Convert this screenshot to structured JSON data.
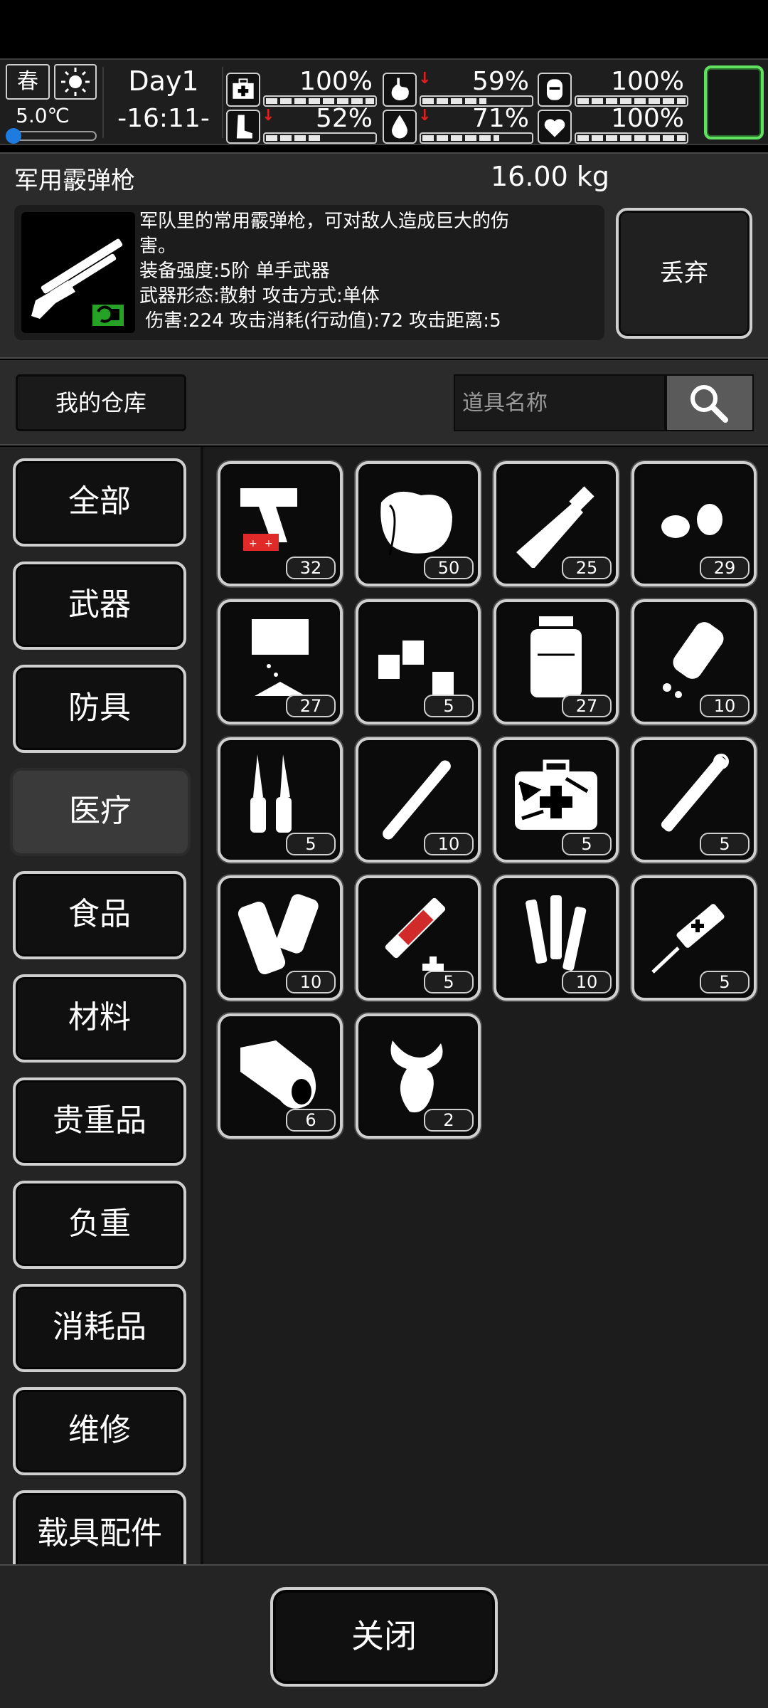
{
  "status": {
    "season": "春",
    "temperature": "5.0℃",
    "temperature_level": 0.1,
    "day": "Day1",
    "time": "-16:11-",
    "stats": [
      {
        "icon": "medkit-icon",
        "value": "100%",
        "level": 1.0,
        "decreasing": false
      },
      {
        "icon": "stomach-icon",
        "value": "59%",
        "level": 0.59,
        "decreasing": true
      },
      {
        "icon": "bladder-icon",
        "value": "100%",
        "level": 1.0,
        "decreasing": false
      },
      {
        "icon": "leg-icon",
        "value": "52%",
        "level": 0.52,
        "decreasing": true
      },
      {
        "icon": "water-drop-icon",
        "value": "71%",
        "level": 0.71,
        "decreasing": true
      },
      {
        "icon": "heart-icon",
        "value": "100%",
        "level": 1.0,
        "decreasing": false
      }
    ],
    "accent_color": "#5fe05f"
  },
  "selected_item": {
    "name": "军用霰弹枪",
    "weight": "16.00 kg",
    "description_lines": [
      "军队里的常用霰弹枪，可对敌人造成巨大的伤",
      "害。",
      "装备强度:5阶 单手武器",
      "武器形态:散射 攻击方式:单体",
      " 伤害:224 攻击消耗(行动值):72 攻击距离:5"
    ],
    "discard_label": "丢弃"
  },
  "warehouse": {
    "label": "我的仓库",
    "search_placeholder": "道具名称"
  },
  "categories": [
    {
      "label": "全部",
      "active": false
    },
    {
      "label": "武器",
      "active": false
    },
    {
      "label": "防具",
      "active": false
    },
    {
      "label": "医疗",
      "active": true
    },
    {
      "label": "食品",
      "active": false
    },
    {
      "label": "材料",
      "active": false
    },
    {
      "label": "贵重品",
      "active": false
    },
    {
      "label": "负重",
      "active": false
    },
    {
      "label": "消耗品",
      "active": false
    },
    {
      "label": "维修",
      "active": false
    },
    {
      "label": "载具配件",
      "active": false
    }
  ],
  "items": [
    {
      "icon": "flare-gun-icon",
      "qty": "32"
    },
    {
      "icon": "bandage-roll-icon",
      "qty": "50"
    },
    {
      "icon": "ointment-tube-icon",
      "qty": "25"
    },
    {
      "icon": "pills-icon",
      "qty": "29"
    },
    {
      "icon": "cloth-icon",
      "qty": "27"
    },
    {
      "icon": "small-bottles-icon",
      "qty": "5"
    },
    {
      "icon": "medicine-jar-icon",
      "qty": "27"
    },
    {
      "icon": "pill-bottle-icon",
      "qty": "10"
    },
    {
      "icon": "ampoules-icon",
      "qty": "5"
    },
    {
      "icon": "tube-icon",
      "qty": "10"
    },
    {
      "icon": "camo-medkit-icon",
      "qty": "5"
    },
    {
      "icon": "injector-pen-icon",
      "qty": "5"
    },
    {
      "icon": "splint-icon",
      "qty": "10"
    },
    {
      "icon": "red-syringe-icon",
      "qty": "5"
    },
    {
      "icon": "vials-icon",
      "qty": "10"
    },
    {
      "icon": "syringe-icon",
      "qty": "5"
    },
    {
      "icon": "gauze-roll-icon",
      "qty": "6"
    },
    {
      "icon": "herb-root-icon",
      "qty": "2"
    }
  ],
  "close_label": "关闭"
}
